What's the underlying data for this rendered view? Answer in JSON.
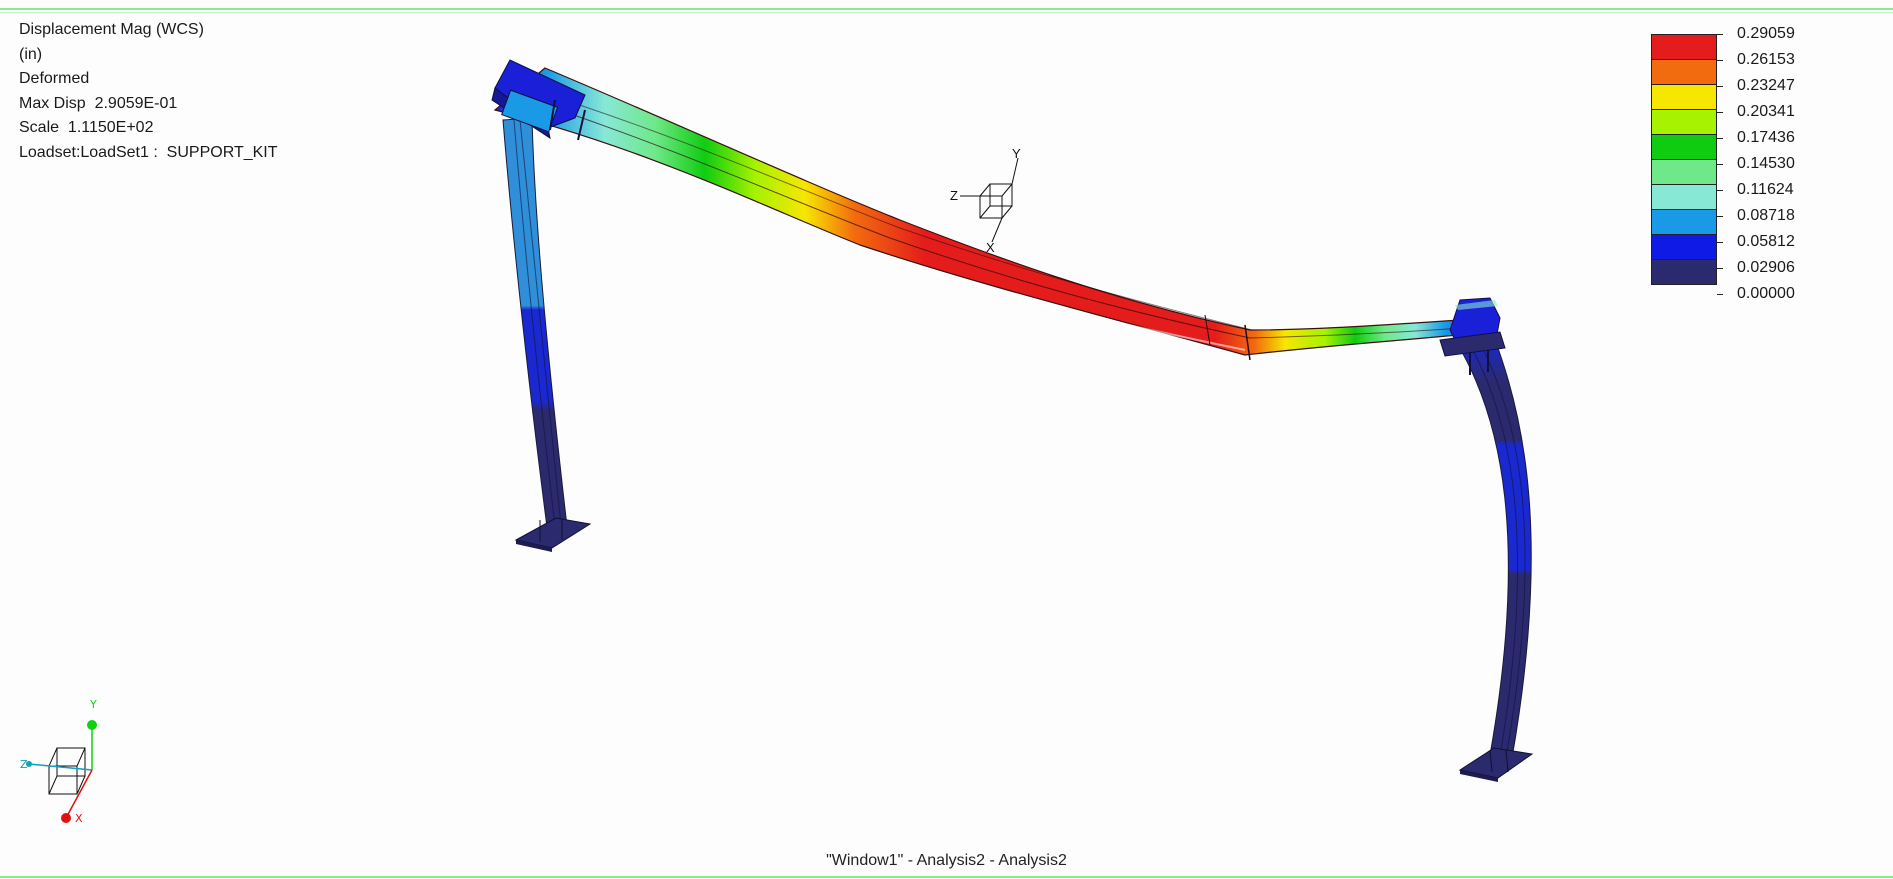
{
  "result_info": {
    "title": "Displacement Mag (WCS)",
    "units": "(in)",
    "mode": "Deformed",
    "max_disp": "Max Disp  2.9059E-01",
    "scale": "Scale  1.1150E+02",
    "loadset": "Loadset:LoadSet1 :  SUPPORT_KIT"
  },
  "legend": {
    "values": [
      "0.29059",
      "0.26153",
      "0.23247",
      "0.20341",
      "0.17436",
      "0.14530",
      "0.11624",
      "0.08718",
      "0.05812",
      "0.02906",
      "0.00000"
    ],
    "colors": [
      "#e41c1c",
      "#f26b0f",
      "#f7e600",
      "#a6f200",
      "#10cc10",
      "#6fe88a",
      "#88e8d6",
      "#1a9ae6",
      "#0f1ae6",
      "#2b2a6e"
    ]
  },
  "triad": {
    "x_label": "X",
    "y_label": "Y",
    "z_label": "Z",
    "x_color": "#e01010",
    "y_color": "#10d010",
    "z_color": "#10a0c0"
  },
  "window_caption": "\"Window1\" - Analysis2 - Analysis2"
}
